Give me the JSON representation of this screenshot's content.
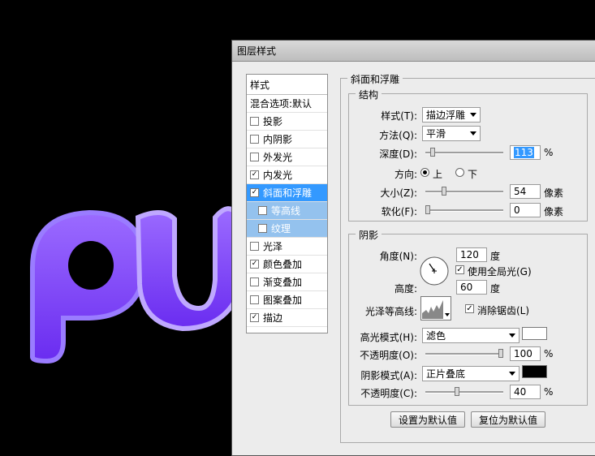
{
  "dialog": {
    "title": "图层样式"
  },
  "styles_list": {
    "header": "样式",
    "blending": "混合选项:默认",
    "items": [
      {
        "label": "投影",
        "checked": false
      },
      {
        "label": "内阴影",
        "checked": false
      },
      {
        "label": "外发光",
        "checked": false
      },
      {
        "label": "内发光",
        "checked": true
      },
      {
        "label": "斜面和浮雕",
        "checked": true
      },
      {
        "label": "等高线",
        "checked": false
      },
      {
        "label": "纹理",
        "checked": false
      },
      {
        "label": "光泽",
        "checked": false
      },
      {
        "label": "颜色叠加",
        "checked": true
      },
      {
        "label": "渐变叠加",
        "checked": false
      },
      {
        "label": "图案叠加",
        "checked": false
      },
      {
        "label": "描边",
        "checked": true
      }
    ]
  },
  "bevel": {
    "section_title": "斜面和浮雕",
    "structure": {
      "title": "结构",
      "style_label": "样式(T):",
      "style_value": "描边浮雕",
      "technique_label": "方法(Q):",
      "technique_value": "平滑",
      "depth_label": "深度(D):",
      "depth_value": "113",
      "depth_unit": "%",
      "direction_label": "方向:",
      "direction_up": "上",
      "direction_down": "下",
      "size_label": "大小(Z):",
      "size_value": "54",
      "size_unit": "像素",
      "soften_label": "软化(F):",
      "soften_value": "0",
      "soften_unit": "像素"
    },
    "shading": {
      "title": "阴影",
      "angle_label": "角度(N):",
      "angle_value": "120",
      "angle_unit": "度",
      "global_light_label": "使用全局光(G)",
      "altitude_label": "高度:",
      "altitude_value": "60",
      "altitude_unit": "度",
      "gloss_contour_label": "光泽等高线:",
      "anti_alias_label": "消除锯齿(L)",
      "highlight_mode_label": "高光模式(H):",
      "highlight_mode_value": "滤色",
      "highlight_opacity_label": "不透明度(O):",
      "highlight_opacity_value": "100",
      "highlight_opacity_unit": "%",
      "shadow_mode_label": "阴影模式(A):",
      "shadow_mode_value": "正片叠底",
      "shadow_opacity_label": "不透明度(C):",
      "shadow_opacity_value": "40",
      "shadow_opacity_unit": "%",
      "highlight_color": "#ffffff",
      "shadow_color": "#000000"
    }
  },
  "buttons": {
    "make_default": "设置为默认值",
    "reset_default": "复位为默认值"
  },
  "canvas": {
    "art_text": "PU",
    "fill_color": "#7a3cf5"
  }
}
